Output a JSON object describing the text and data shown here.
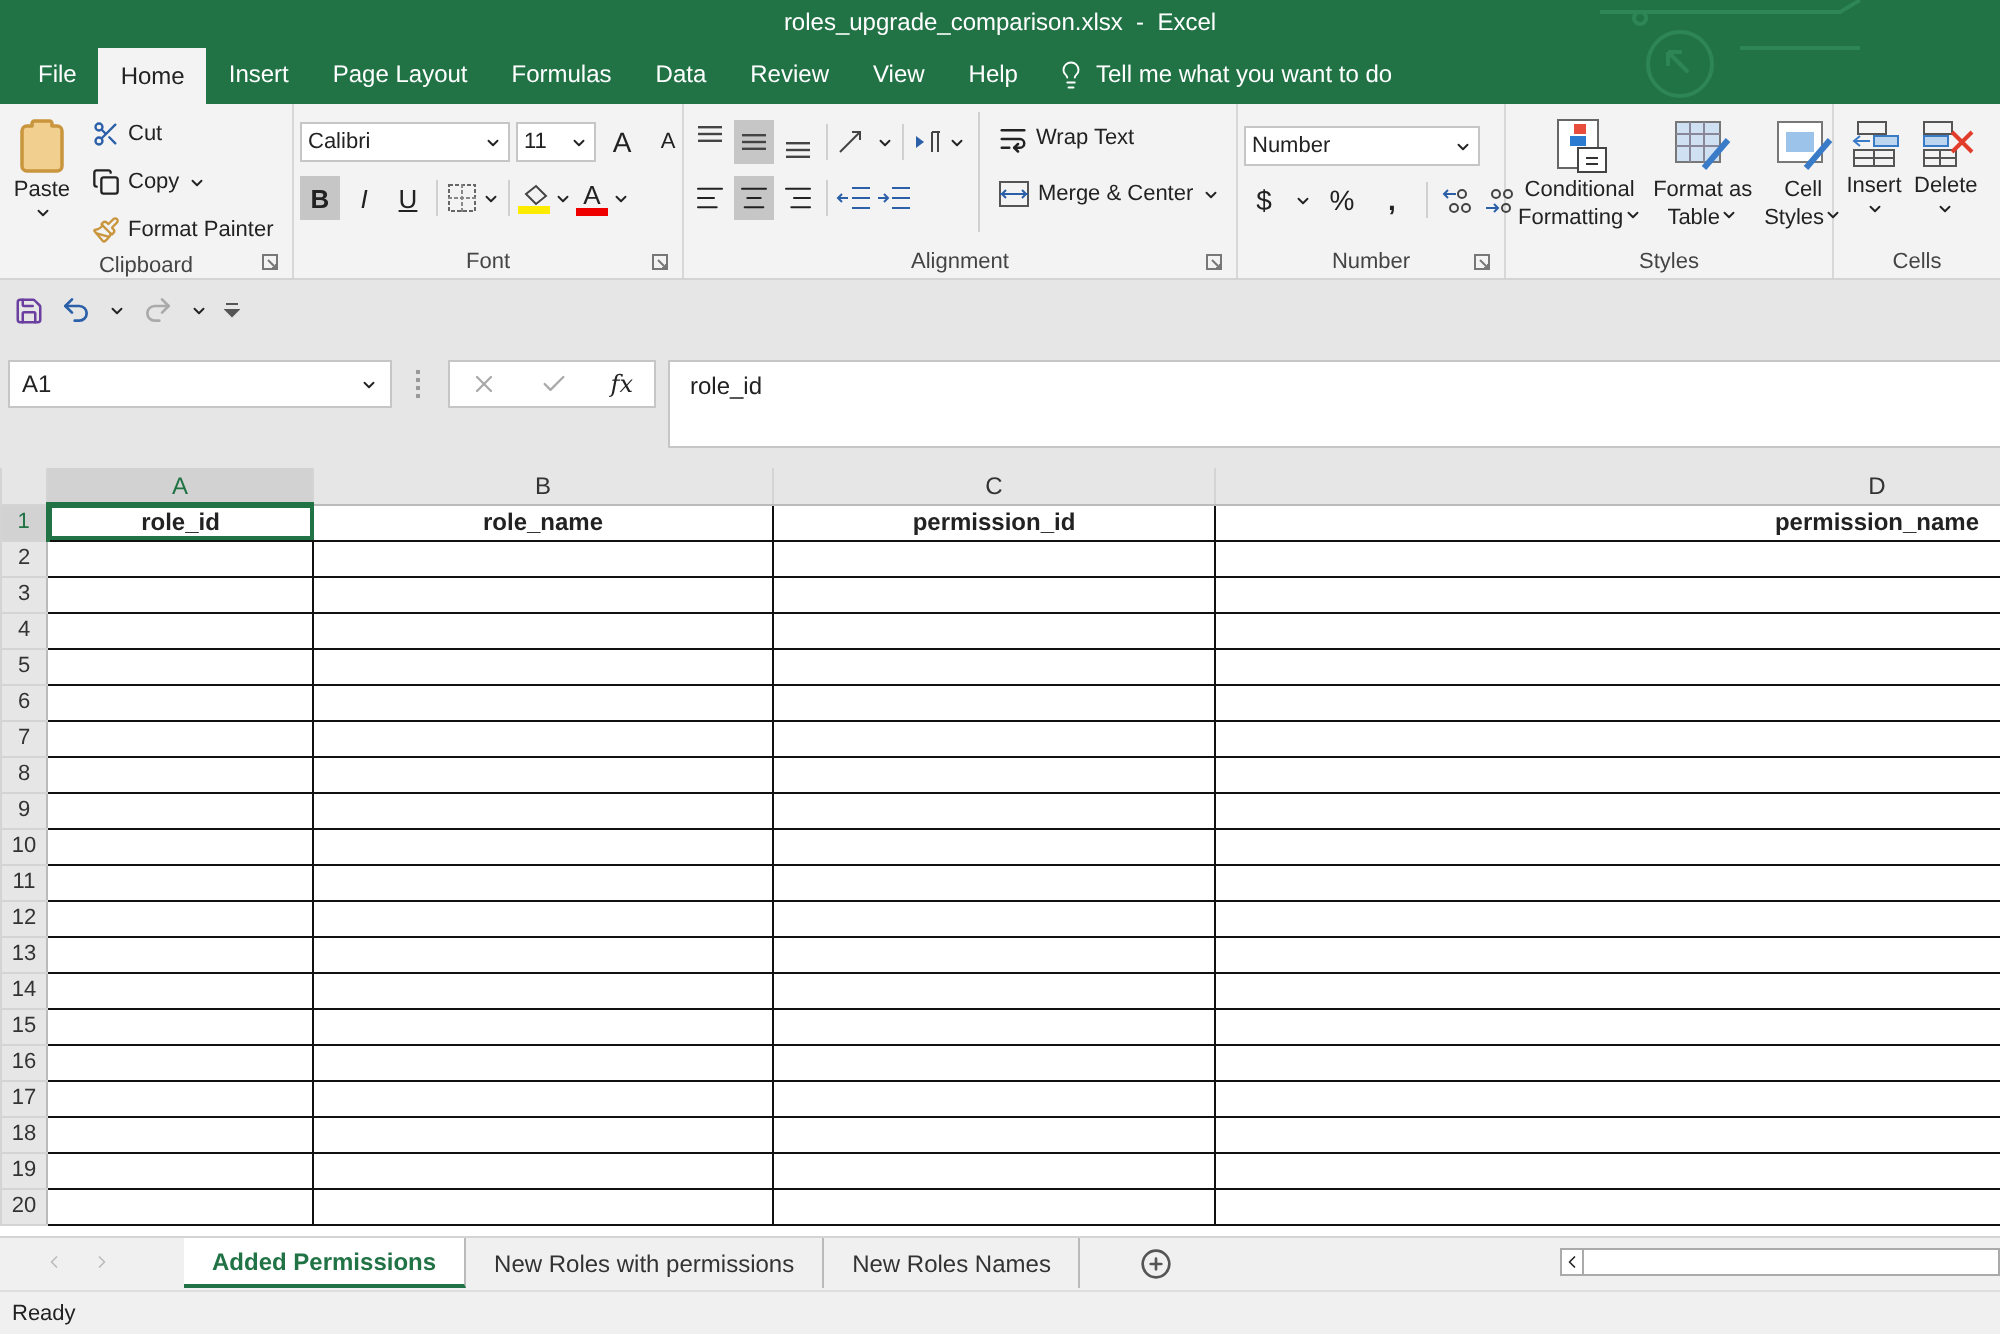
{
  "window": {
    "title": "roles_upgrade_comparison.xlsx  -  Excel"
  },
  "ribbon_tabs": [
    {
      "label": "File",
      "selected": false
    },
    {
      "label": "Home",
      "selected": true
    },
    {
      "label": "Insert",
      "selected": false
    },
    {
      "label": "Page Layout",
      "selected": false
    },
    {
      "label": "Formulas",
      "selected": false
    },
    {
      "label": "Data",
      "selected": false
    },
    {
      "label": "Review",
      "selected": false
    },
    {
      "label": "View",
      "selected": false
    },
    {
      "label": "Help",
      "selected": false
    }
  ],
  "tell_me": "Tell me what you want to do",
  "clipboard": {
    "label": "Clipboard",
    "paste": "Paste",
    "cut": "Cut",
    "copy": "Copy",
    "format_painter": "Format Painter"
  },
  "font": {
    "label": "Font",
    "font_name": "Calibri",
    "font_size": "11",
    "grow": "A",
    "shrink": "A",
    "color_letter": "A",
    "styles": [
      {
        "label": "B",
        "selected": true
      },
      {
        "label": "I",
        "selected": false
      },
      {
        "label": "U",
        "selected": false
      }
    ]
  },
  "alignment": {
    "label": "Alignment",
    "wrap_text": "Wrap Text",
    "merge": "Merge & Center",
    "vertical": [
      {
        "kind": "top",
        "selected": false
      },
      {
        "kind": "middle",
        "selected": true
      },
      {
        "kind": "bottom",
        "selected": false
      }
    ],
    "horizontal": [
      {
        "kind": "left",
        "selected": false
      },
      {
        "kind": "center",
        "selected": true
      },
      {
        "kind": "right",
        "selected": false
      }
    ]
  },
  "number": {
    "label": "Number",
    "format": "Number",
    "currency": "$",
    "percent": "%",
    "comma": ","
  },
  "styles": {
    "label": "Styles",
    "buttons": [
      {
        "kind": "conditional",
        "lines": [
          "Conditional",
          "Formatting"
        ]
      },
      {
        "kind": "table",
        "lines": [
          "Format as",
          "Table"
        ]
      },
      {
        "kind": "cell",
        "lines": [
          "Cell",
          "Styles"
        ]
      }
    ]
  },
  "cells": {
    "label": "Cells",
    "buttons": [
      {
        "kind": "insert",
        "label": "Insert"
      },
      {
        "kind": "delete",
        "label": "Delete"
      }
    ]
  },
  "formula_bar": {
    "name_box": "A1",
    "function_symbol": "fx",
    "formula": "role_id"
  },
  "grid": {
    "columns": [
      {
        "letter": "A",
        "selected": true
      },
      {
        "letter": "B",
        "selected": false
      },
      {
        "letter": "C",
        "selected": false
      },
      {
        "letter": "D",
        "selected": false
      }
    ],
    "header_cells": [
      {
        "text": "role_id",
        "selected": true
      },
      {
        "text": "role_name",
        "selected": false
      },
      {
        "text": "permission_id",
        "selected": false
      },
      {
        "text": "permission_name",
        "selected": false
      }
    ],
    "row_numbers": [
      "1",
      "2",
      "3",
      "4",
      "5",
      "6",
      "7",
      "8",
      "9",
      "10",
      "11",
      "12",
      "13",
      "14",
      "15",
      "16",
      "17",
      "18",
      "19",
      "20"
    ]
  },
  "sheet_tabs": [
    {
      "label": "Added Permissions",
      "selected": true
    },
    {
      "label": "New Roles with permissions",
      "selected": false
    },
    {
      "label": "New Roles Names",
      "selected": false
    }
  ],
  "status_bar": {
    "text": "Ready"
  }
}
